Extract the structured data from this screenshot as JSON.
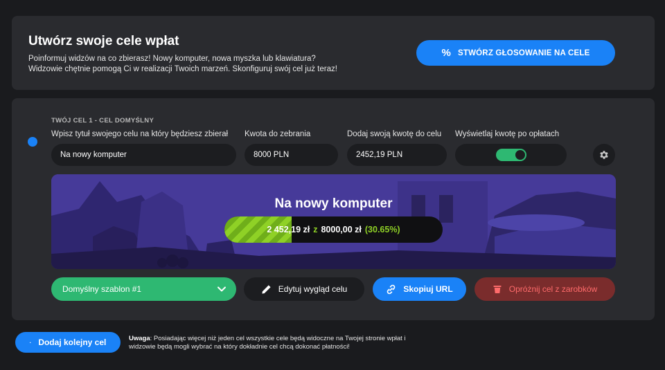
{
  "header": {
    "title": "Utwórz swoje cele wpłat",
    "description_line1": "Poinformuj widzów na co zbierasz! Nowy komputer, nowa myszka lub klawiatura?",
    "description_line2": "Widzowie chętnie pomogą Ci w realizacji Twoich marzeń. Skonfiguruj swój cel już teraz!",
    "vote_button_icon": "%",
    "vote_button_label": "STWÓRZ GŁOSOWANIE NA CELE"
  },
  "goal": {
    "heading": "TWÓJ CEL 1 - CEL DOMYŚLNY",
    "title_label": "Wpisz tytuł swojego celu na który będziesz zbierał",
    "title_value": "Na nowy komputer",
    "amount_label": "Kwota do zebrania",
    "amount_value": "8000 PLN",
    "own_amount_label": "Dodaj swoją kwotę do celu",
    "own_amount_value": "2452,19 PLN",
    "show_amount_label": "Wyświetlaj kwotę po opłatach",
    "show_amount_enabled": true,
    "preview": {
      "title": "Na nowy komputer",
      "collected": "2 452,19 zł",
      "separator": "z",
      "target": "8000,00 zł",
      "percent_text": "(30.65%)",
      "progress_fraction": 0.3065
    },
    "template_label": "Domyślny szablon #1",
    "edit_label": "Edytuj wygląd celu",
    "copy_label": "Skopiuj URL",
    "clear_label": "Opróżnij cel z zarobków"
  },
  "footer": {
    "add_icon": "·",
    "add_label": "Dodaj kolejny cel",
    "note_bold": "Uwaga",
    "note_line1": ": Posiadając więcej niż jeden cel wszystkie cele będą widoczne na Twojej stronie wpłat i",
    "note_line2": "widzowie będą mogli wybrać na który dokładnie cel chcą dokonać płatności!"
  },
  "colors": {
    "accent": "#1a82f7",
    "success": "#2eb872",
    "danger": "#7a2c2c",
    "progress": "#8fd126"
  }
}
